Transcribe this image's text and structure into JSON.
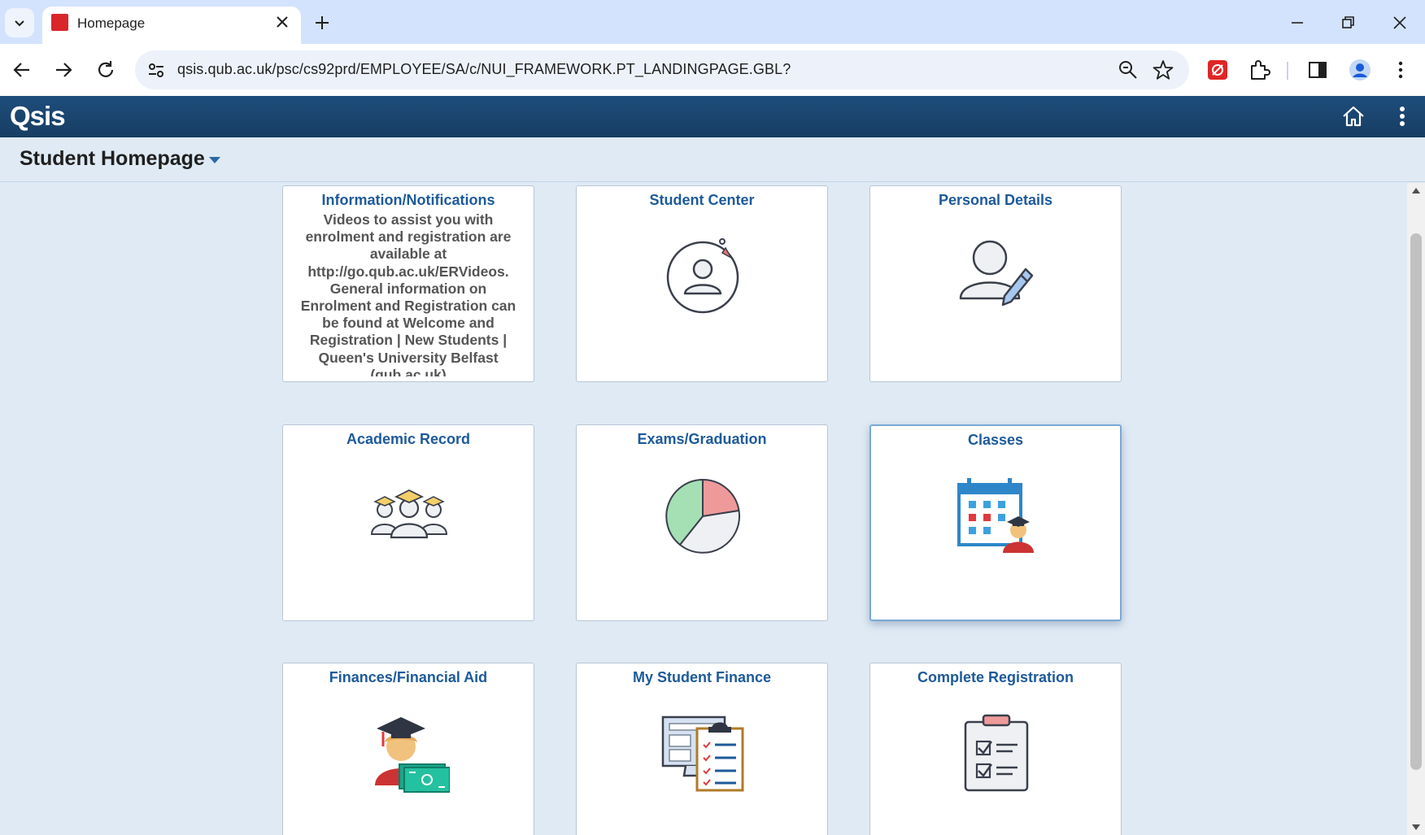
{
  "browser": {
    "tab_title": "Homepage",
    "url": "qsis.qub.ac.uk/psc/cs92prd/EMPLOYEE/SA/c/NUI_FRAMEWORK.PT_LANDINGPAGE.GBL?"
  },
  "app": {
    "logo": "Qsis",
    "page_title": "Student Homepage"
  },
  "tiles": [
    {
      "title": "Information/Notifications",
      "icon": "info-text",
      "text": "Videos to assist you with enrolment and registration are available at http://go.qub.ac.uk/ERVideos. General information on Enrolment and Registration can be found at Welcome and Registration | New Students | Queen's University Belfast (qub.ac.uk)"
    },
    {
      "title": "Student Center",
      "icon": "student-center-icon"
    },
    {
      "title": "Personal Details",
      "icon": "person-edit-icon"
    },
    {
      "title": "Academic Record",
      "icon": "graduates-group-icon"
    },
    {
      "title": "Exams/Graduation",
      "icon": "pie-chart-icon"
    },
    {
      "title": "Classes",
      "icon": "calendar-student-icon",
      "focused": true
    },
    {
      "title": "Finances/Financial Aid",
      "icon": "graduate-money-icon"
    },
    {
      "title": "My Student Finance",
      "icon": "monitor-clipboard-icon"
    },
    {
      "title": "Complete Registration",
      "icon": "checklist-clipboard-icon"
    }
  ],
  "colors": {
    "header_bg": "#1e4d7b",
    "page_bg": "#dfeaf4",
    "tile_title": "#1d5a9a",
    "browser_tabbar": "#d3e3fd"
  }
}
